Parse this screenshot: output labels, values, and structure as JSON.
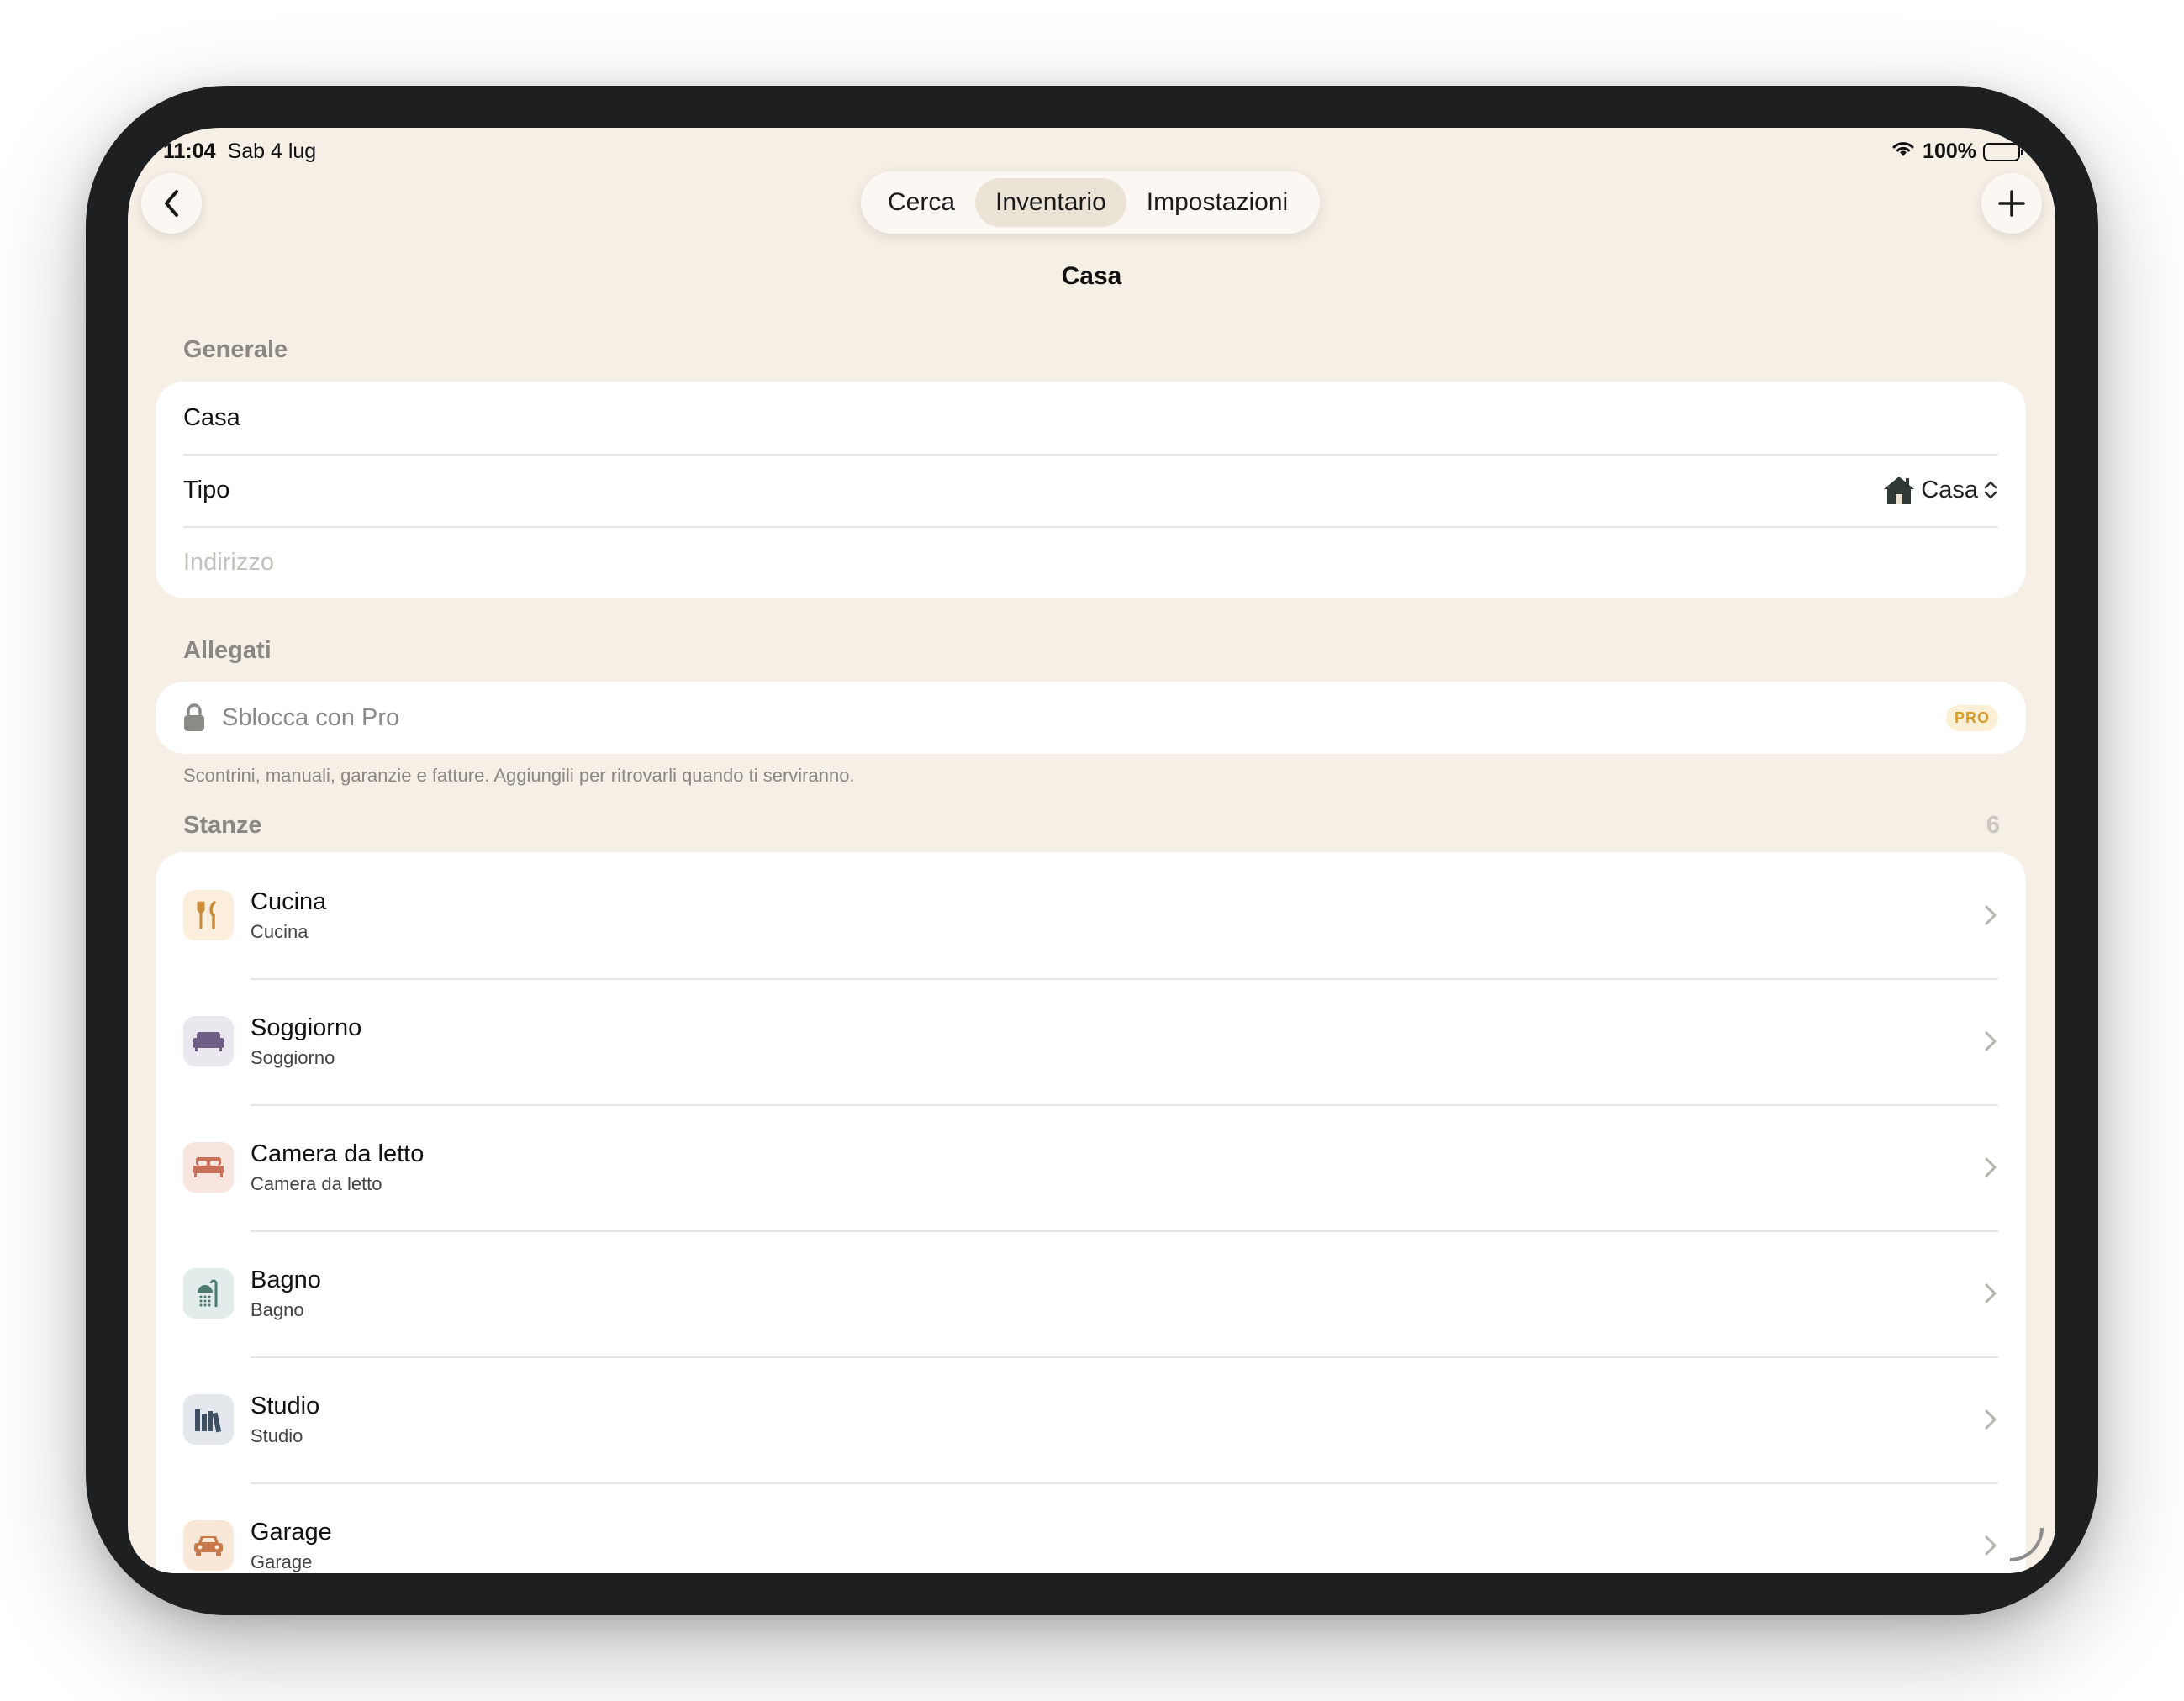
{
  "status_bar": {
    "time": "11:04",
    "date": "Sab 4 lug",
    "battery": "100%"
  },
  "nav": {
    "tabs": [
      {
        "label": "Cerca"
      },
      {
        "label": "Inventario"
      },
      {
        "label": "Impostazioni"
      }
    ],
    "active_tab": "Inventario",
    "title": "Casa"
  },
  "general": {
    "label": "Generale",
    "name_value": "Casa",
    "type_label": "Tipo",
    "type_value": "Casa",
    "address_placeholder": "Indirizzo"
  },
  "attachments": {
    "label": "Allegati",
    "unlock_label": "Sblocca con Pro",
    "badge": "PRO",
    "footnote": "Scontrini, manuali, garanzie e fatture. Aggiungili per ritrovarli quando ti serviranno."
  },
  "rooms": {
    "label": "Stanze",
    "count": "6",
    "items": [
      {
        "title": "Cucina",
        "subtitle": "Cucina",
        "icon": "fork-knife-icon",
        "bg": "#fbeedd",
        "color": "#c98a3a"
      },
      {
        "title": "Soggiorno",
        "subtitle": "Soggiorno",
        "icon": "sofa-icon",
        "bg": "#ebe7ee",
        "color": "#6e5e86"
      },
      {
        "title": "Camera da letto",
        "subtitle": "Camera da letto",
        "icon": "bed-icon",
        "bg": "#f9e5df",
        "color": "#c9705a"
      },
      {
        "title": "Bagno",
        "subtitle": "Bagno",
        "icon": "shower-icon",
        "bg": "#e2ecea",
        "color": "#4c7a70"
      },
      {
        "title": "Studio",
        "subtitle": "Studio",
        "icon": "books-icon",
        "bg": "#e4e7eb",
        "color": "#3f4f63"
      },
      {
        "title": "Garage",
        "subtitle": "Garage",
        "icon": "car-icon",
        "bg": "#f9e7d8",
        "color": "#c9784a"
      }
    ]
  }
}
